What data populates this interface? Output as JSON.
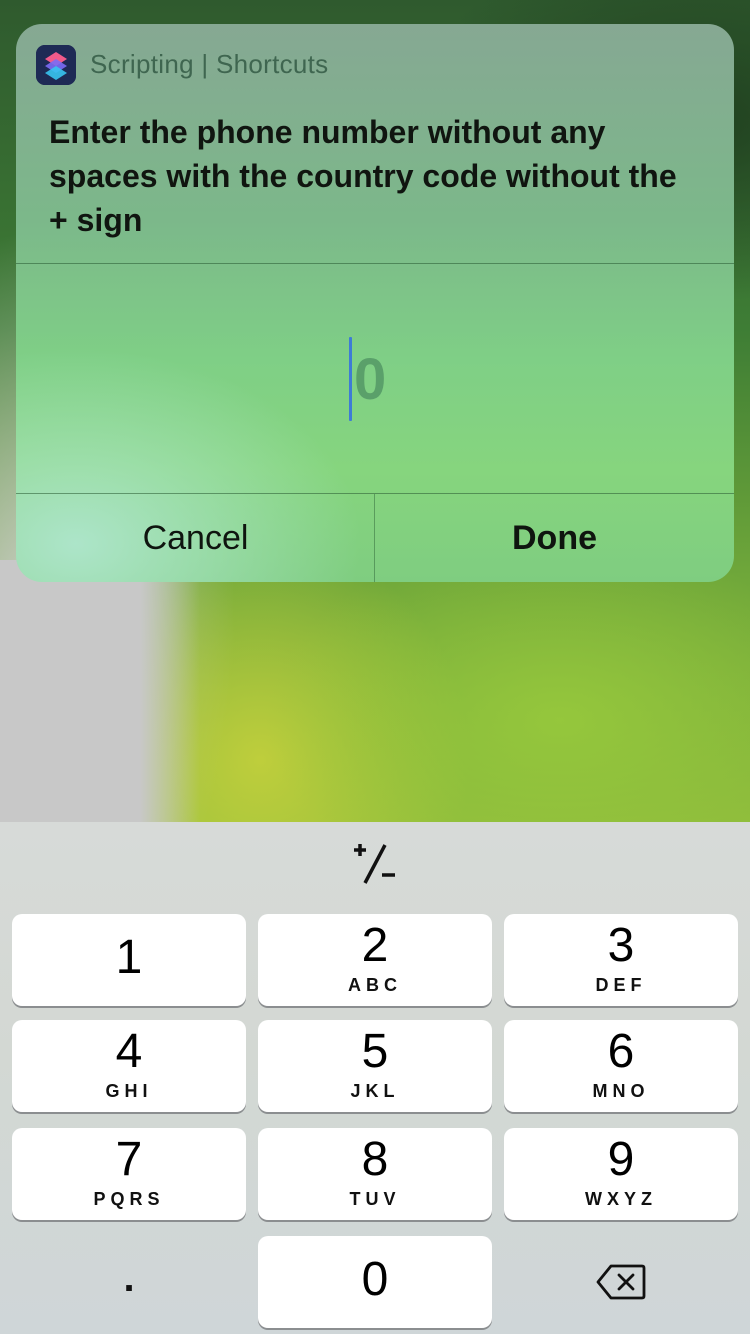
{
  "alert": {
    "app_name": "Scripting | Shortcuts",
    "prompt": "Enter the phone number without any spaces with the country code without the + sign",
    "input_placeholder": "0",
    "cancel_label": "Cancel",
    "done_label": "Done"
  },
  "keyboard": {
    "sign_key": "+∕−",
    "keys": [
      {
        "digit": "1",
        "letters": ""
      },
      {
        "digit": "2",
        "letters": "ABC"
      },
      {
        "digit": "3",
        "letters": "DEF"
      },
      {
        "digit": "4",
        "letters": "GHI"
      },
      {
        "digit": "5",
        "letters": "JKL"
      },
      {
        "digit": "6",
        "letters": "MNO"
      },
      {
        "digit": "7",
        "letters": "PQRS"
      },
      {
        "digit": "8",
        "letters": "TUV"
      },
      {
        "digit": "9",
        "letters": "WXYZ"
      },
      {
        "digit": "0",
        "letters": ""
      }
    ],
    "decimal_key": ".",
    "delete_icon": "backspace-icon"
  },
  "colors": {
    "cursor": "#3e7bd6",
    "key_background": "#ffffff",
    "keyboard_background": "#d5d9d6"
  }
}
